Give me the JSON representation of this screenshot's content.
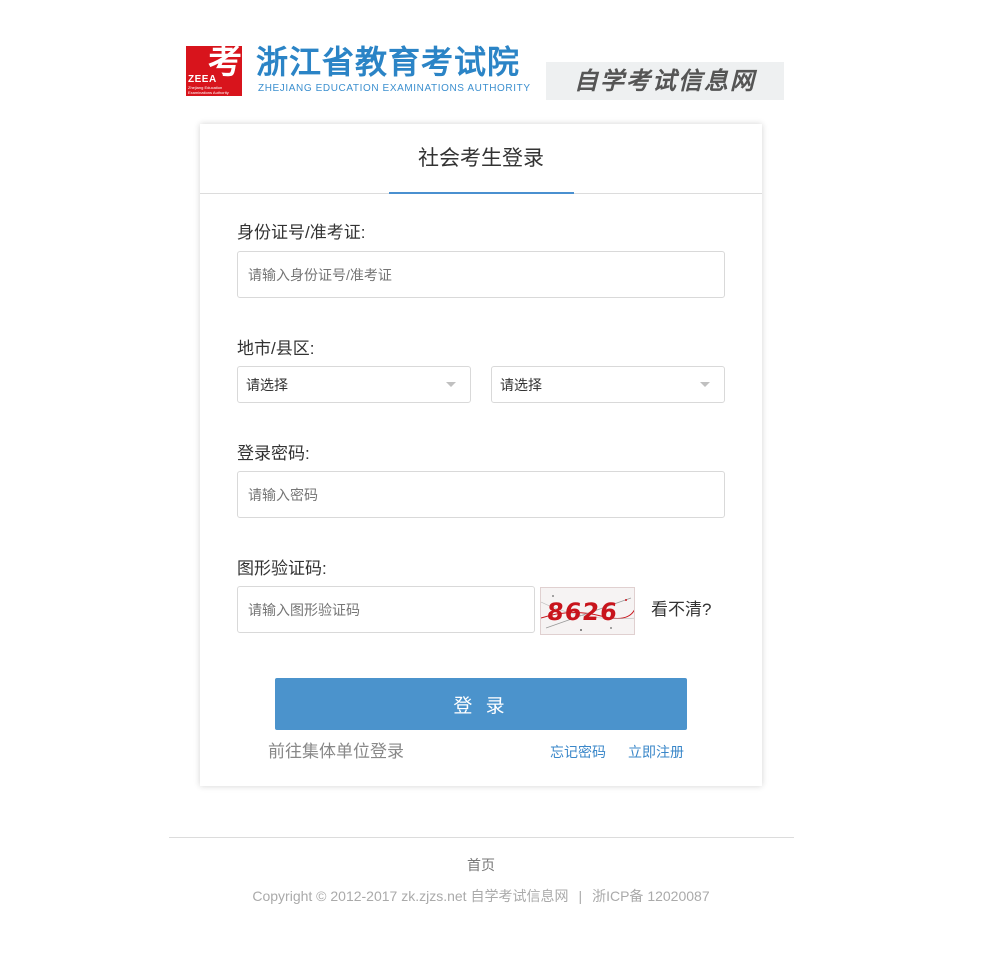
{
  "header": {
    "logo_glyph": "考",
    "logo_abbr": "ZEEA",
    "logo_small_text": "Zhejiang Education Examinations Authority",
    "org_name": "浙江省教育考试院",
    "org_name_en": "ZHEJIANG EDUCATION EXAMINATIONS AUTHORITY",
    "site_name": "自学考试信息网"
  },
  "login": {
    "title": "社会考生登录",
    "id_label": "身份证号/准考证:",
    "id_placeholder": "请输入身份证号/准考证",
    "region_label": "地市/县区:",
    "city_select": "请选择",
    "district_select": "请选择",
    "password_label": "登录密码:",
    "password_placeholder": "请输入密码",
    "captcha_label": "图形验证码:",
    "captcha_placeholder": "请输入图形验证码",
    "captcha_text": "8626",
    "refresh_label": "看不清?",
    "submit_label": "登 录",
    "group_login_link": "前往集体单位登录",
    "forgot_link": "忘记密码",
    "register_link": "立即注册"
  },
  "footer": {
    "home_link": "首页",
    "copyright": "Copyright © 2012-2017 zk.zjzs.net 自学考试信息网",
    "separator": "|",
    "icp": "浙ICP备 12020087"
  },
  "colors": {
    "accent_blue": "#4b93cc",
    "logo_red": "#d8141c",
    "link_blue": "#3a87c9"
  }
}
